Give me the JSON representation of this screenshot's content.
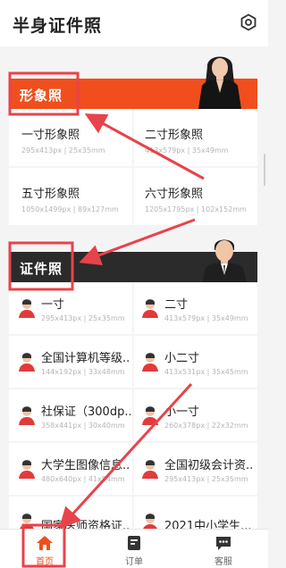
{
  "header": {
    "title": "半身证件照",
    "settings_icon": "settings-hex-icon"
  },
  "sections": {
    "portrait": {
      "title": "形象照"
    },
    "id": {
      "title": "证件照"
    }
  },
  "portrait_items": [
    {
      "name": "一寸形象照",
      "spec": "295x413px | 25x35mm"
    },
    {
      "name": "二寸形象照",
      "spec": "413x579px | 35x49mm"
    },
    {
      "name": "五寸形象照",
      "spec": "1050x1499px | 89x127mm"
    },
    {
      "name": "六寸形象照",
      "spec": "1205x1795px | 102x152mm"
    }
  ],
  "id_items": [
    {
      "name": "一寸",
      "spec": "295x413px | 25x35mm"
    },
    {
      "name": "二寸",
      "spec": "413x579px | 35x49mm"
    },
    {
      "name": "全国计算机等级...",
      "spec": "144x192px | 33x48mm"
    },
    {
      "name": "小二寸",
      "spec": "413x531px | 35x45mm"
    },
    {
      "name": "社保证（300dp...",
      "spec": "358x441px | 30x40mm"
    },
    {
      "name": "小一寸",
      "spec": "260x378px | 22x32mm"
    },
    {
      "name": "大学生图像信息...",
      "spec": "480x640px | 41x54mm"
    },
    {
      "name": "全国初级会计资...",
      "spec": "295x413px | 25x35mm"
    },
    {
      "name": "国家医师资格证...",
      "spec": ""
    },
    {
      "name": "2021中小学生...",
      "spec": ""
    }
  ],
  "tabs": [
    {
      "label": "首页",
      "icon": "home-icon",
      "active": true
    },
    {
      "label": "订单",
      "icon": "order-icon",
      "active": false
    },
    {
      "label": "客服",
      "icon": "chat-icon",
      "active": false
    }
  ],
  "colors": {
    "accent": "#f04f1d",
    "annotation": "#e8434a",
    "dark_banner": "#2b2b2b"
  }
}
